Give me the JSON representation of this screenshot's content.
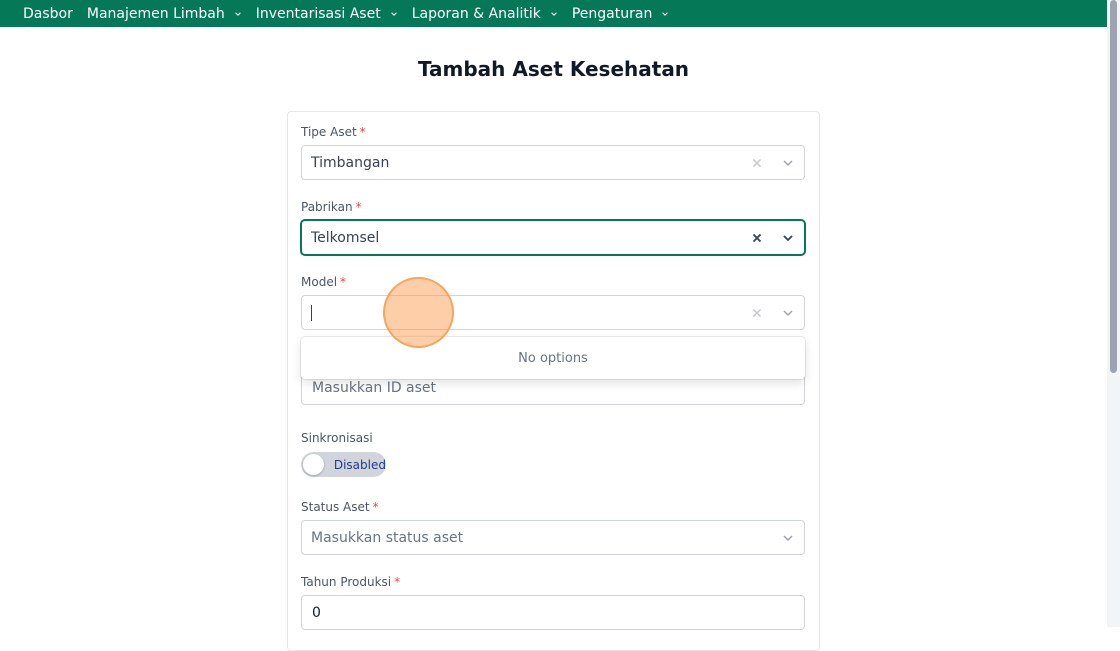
{
  "nav": {
    "items": [
      {
        "label": "Dasbor",
        "has_dropdown": false
      },
      {
        "label": "Manajemen Limbah",
        "has_dropdown": true
      },
      {
        "label": "Inventarisasi Aset",
        "has_dropdown": true
      },
      {
        "label": "Laporan & Analitik",
        "has_dropdown": true
      },
      {
        "label": "Pengaturan",
        "has_dropdown": true
      }
    ],
    "bg_color": "#047857"
  },
  "page": {
    "title": "Tambah Aset Kesehatan"
  },
  "form": {
    "required_mark": "*",
    "tipe_aset": {
      "label": "Tipe Aset",
      "value": "Timbangan"
    },
    "pabrikan": {
      "label": "Pabrikan",
      "value": "Telkomsel"
    },
    "model": {
      "label": "Model",
      "value": "",
      "menu_message": "No options"
    },
    "id_aset": {
      "placeholder": "Masukkan ID aset"
    },
    "sinkronisasi": {
      "label": "Sinkronisasi",
      "state": "Disabled"
    },
    "status_aset": {
      "label": "Status Aset",
      "placeholder": "Masukkan status aset"
    },
    "tahun_produksi": {
      "label": "Tahun Produksi",
      "value": "0"
    }
  },
  "colors": {
    "accent": "#047857",
    "required": "#ef4444",
    "click_indicator": "#fb923c"
  }
}
